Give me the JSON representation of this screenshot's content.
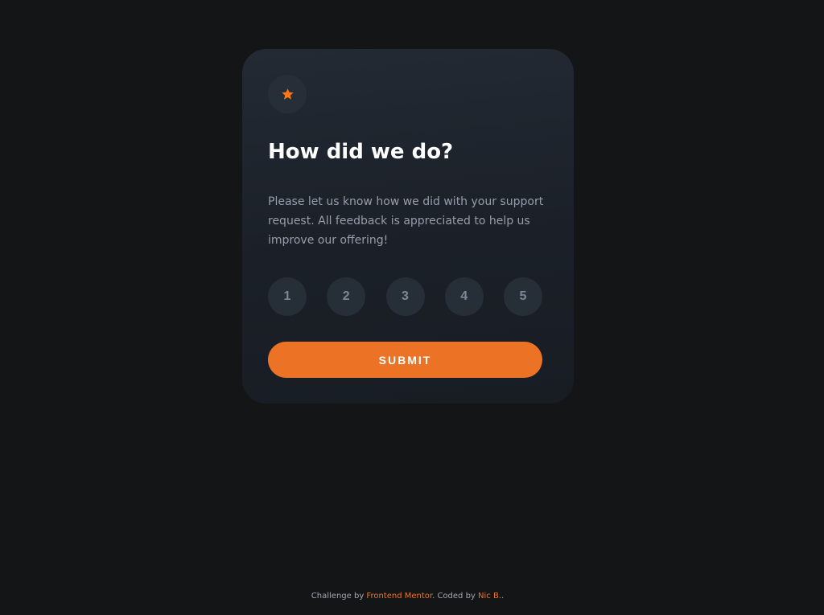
{
  "card": {
    "icon": "star-icon",
    "title": "How did we do?",
    "description": "Please let us know how we did with your support request. All feedback is appreciated to help us improve our offering!",
    "ratings": [
      "1",
      "2",
      "3",
      "4",
      "5"
    ],
    "submit_label": "SUBMIT"
  },
  "footer": {
    "prefix": "Challenge by ",
    "challenge_link": "Frontend Mentor",
    "middle": ". Coded by ",
    "author_link": "Nic B.",
    "suffix": "."
  },
  "colors": {
    "background": "#141517",
    "card": "#1f252e",
    "accent": "#ec7326",
    "muted_text": "#959eac",
    "rating_text": "#7c8798"
  }
}
